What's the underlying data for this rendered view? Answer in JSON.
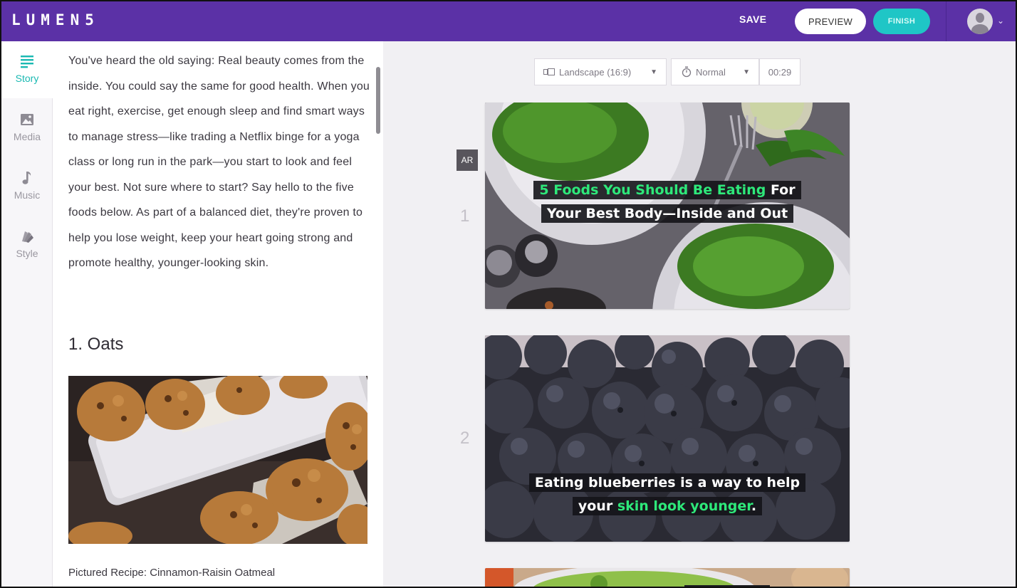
{
  "app": {
    "logo": "LUMEN5"
  },
  "topbar": {
    "save_label": "SAVE",
    "preview_label": "PREVIEW",
    "finish_label": "FINISH"
  },
  "sidenav": {
    "items": [
      {
        "label": "Story",
        "icon": "story-lines-icon",
        "active": true
      },
      {
        "label": "Media",
        "icon": "image-icon",
        "active": false
      },
      {
        "label": "Music",
        "icon": "music-note-icon",
        "active": false
      },
      {
        "label": "Style",
        "icon": "style-swatch-icon",
        "active": false
      }
    ]
  },
  "story": {
    "paragraph": "You've heard the old saying: Real beauty comes from the inside.  You could say the same for good health.  When you eat right, exercise, get enough sleep and find smart ways to manage stress—like trading a Netflix binge for a yoga class or long run in the park—you start to look and feel your best.  Not sure where to start?  Say hello to the five foods below.  As part of a balanced diet, they're proven to help you lose weight, keep your heart going strong and promote healthy, younger-looking skin.",
    "heading": "1. Oats",
    "caption": "Pictured Recipe: Cinnamon-Raisin Oatmeal"
  },
  "controls": {
    "aspect_label": "Landscape (16:9)",
    "speed_label": "Normal",
    "duration": "00:29",
    "ar_label": "AR"
  },
  "slides": [
    {
      "number": "1",
      "caption_highlight": "5 Foods You Should Be Eating",
      "caption_rest_1": " For",
      "caption_line2": "Your Best Body—Inside and Out"
    },
    {
      "number": "2",
      "caption_line1": "Eating blueberries is a way to help",
      "caption_pre": "your ",
      "caption_highlight": "skin look younger",
      "caption_post": "."
    }
  ],
  "colors": {
    "brand_purple": "#5b31a6",
    "accent_teal": "#1fc6c6",
    "highlight_green": "#2ee87a"
  }
}
